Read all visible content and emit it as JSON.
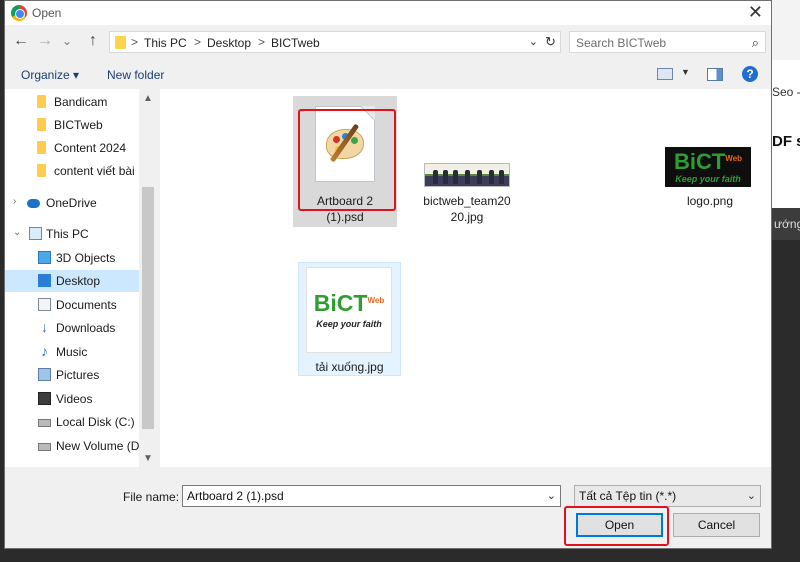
{
  "dialog": {
    "title": "Open",
    "close_glyph": "✕"
  },
  "nav": {
    "back": "←",
    "forward": "→",
    "recent": "⌄",
    "up": "↑",
    "breadcrumbs": [
      "This PC",
      "Desktop",
      "BICTweb"
    ],
    "separator": ">",
    "refresh": "↻",
    "search_placeholder": "Search BICTweb"
  },
  "toolbar": {
    "organize": "Organize ▾",
    "new_folder": "New folder",
    "help": "?"
  },
  "sidebar": {
    "items": [
      {
        "label": "Bandicam",
        "icon": "folder-icon"
      },
      {
        "label": "BICTweb",
        "icon": "folder-icon"
      },
      {
        "label": "Content 2024",
        "icon": "folder-icon"
      },
      {
        "label": "content viết bài",
        "icon": "folder-icon"
      },
      {
        "label": "OneDrive",
        "icon": "onedrive-icon"
      },
      {
        "label": "This PC",
        "icon": "this-pc-icon"
      },
      {
        "label": "3D Objects",
        "icon": "3d-objects-icon"
      },
      {
        "label": "Desktop",
        "icon": "desktop-icon",
        "selected": true
      },
      {
        "label": "Documents",
        "icon": "documents-icon"
      },
      {
        "label": "Downloads",
        "icon": "downloads-icon"
      },
      {
        "label": "Music",
        "icon": "music-icon"
      },
      {
        "label": "Pictures",
        "icon": "pictures-icon"
      },
      {
        "label": "Videos",
        "icon": "videos-icon"
      },
      {
        "label": "Local Disk (C:)",
        "icon": "local-disk-icon"
      },
      {
        "label": "New Volume (D:)",
        "icon": "new-volume-icon"
      }
    ]
  },
  "files": [
    {
      "name_line1": "Artboard 2",
      "name_line2": "(1).psd",
      "type": "psd"
    },
    {
      "name_line1": "bictweb_team20",
      "name_line2": "20.jpg",
      "type": "jpg"
    },
    {
      "name_line1": "logo.png",
      "name_line2": "",
      "type": "png"
    },
    {
      "name_line1": "tải xuống.jpg",
      "name_line2": "",
      "type": "jpg"
    }
  ],
  "logo": {
    "b": "B",
    "ict": "iCT",
    "web": "Web",
    "tagline": "Keep your faith"
  },
  "bottom": {
    "file_name_label": "File name:",
    "file_name_value": "Artboard 2 (1).psd",
    "file_type_value": "Tất cả Tệp tin (*.*)",
    "open_label": "Open",
    "cancel_label": "Cancel"
  },
  "background": {
    "text_seo": "Seo -",
    "text_df": "DF s",
    "text_tab": "ướng"
  },
  "colors": {
    "highlight": "#e0121b",
    "selection": "#cce8ff",
    "accent": "#0078d7"
  }
}
